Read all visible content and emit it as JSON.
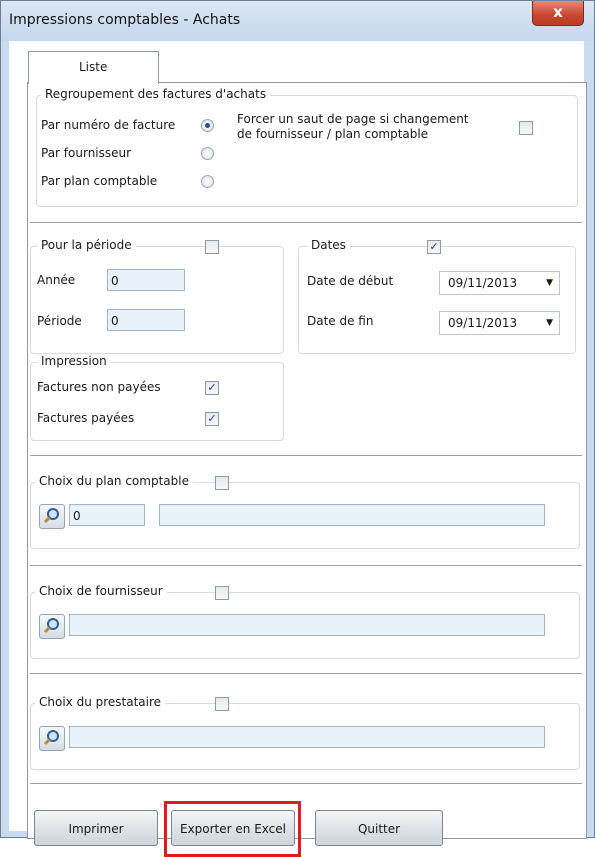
{
  "window": {
    "title": "Impressions comptables - Achats",
    "close_label": "x"
  },
  "tabs": [
    {
      "label": "Liste"
    }
  ],
  "grouping": {
    "legend": "Regroupement des factures d'achats",
    "options": [
      {
        "label": "Par numéro de facture",
        "selected": true
      },
      {
        "label": "Par fournisseur",
        "selected": false
      },
      {
        "label": "Par plan comptable",
        "selected": false
      }
    ],
    "force_break": {
      "label_line1": "Forcer un saut de page si changement",
      "label_line2": "de fournisseur / plan comptable",
      "checked": false
    }
  },
  "period": {
    "legend": "Pour la période",
    "checked": false,
    "year_label": "Année",
    "year_value": "0",
    "period_label": "Période",
    "period_value": "0"
  },
  "dates": {
    "legend": "Dates",
    "checked": true,
    "start_label": "Date de début",
    "start_value": "09/11/2013",
    "end_label": "Date de fin",
    "end_value": "09/11/2013"
  },
  "printing": {
    "legend": "Impression",
    "unpaid_label": "Factures non payées",
    "unpaid_checked": true,
    "paid_label": "Factures payées",
    "paid_checked": true
  },
  "chart_of_accounts": {
    "legend": "Choix du plan comptable",
    "checked": false,
    "code_value": "0",
    "name_value": ""
  },
  "supplier": {
    "legend": "Choix de fournisseur",
    "checked": false,
    "value": ""
  },
  "provider": {
    "legend": "Choix du prestataire",
    "checked": false,
    "value": ""
  },
  "buttons": {
    "print": "Imprimer",
    "export": "Exporter en Excel",
    "quit": "Quitter"
  },
  "colors": {
    "highlight": "#e21b1b",
    "close": "#c8452f",
    "input_bg": "#e9f1fb"
  }
}
